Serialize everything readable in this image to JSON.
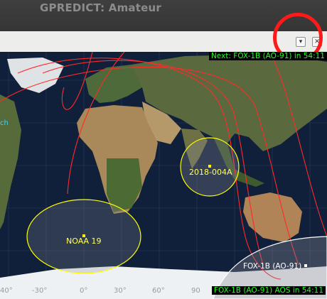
{
  "window": {
    "title": "GPREDICT: Amateur"
  },
  "toolbar": {
    "menu_icon": "dropdown-menu-icon",
    "close_icon": "close-icon",
    "menu_glyph": "▾",
    "close_glyph": "✕"
  },
  "map": {
    "next_event": "Next: FOX-1B (AO-91) in 54:11",
    "aos_event": "FOX-1B (AO-91) AOS in 54:11",
    "left_edge_text": "ch",
    "satellites": [
      {
        "name": "NOAA 19",
        "color": "#ffff00"
      },
      {
        "name": "2018-004A",
        "color": "#ffff00"
      },
      {
        "name": "FOX-1B (AO-91)",
        "color": "#ffffff"
      }
    ],
    "lon_labels": [
      "40°",
      "-30°",
      "0°",
      "30°",
      "60°",
      "90"
    ],
    "colors": {
      "ground_track": "#ff2a2a",
      "footprint": "#ffff00",
      "next_text": "#23ff23"
    }
  }
}
